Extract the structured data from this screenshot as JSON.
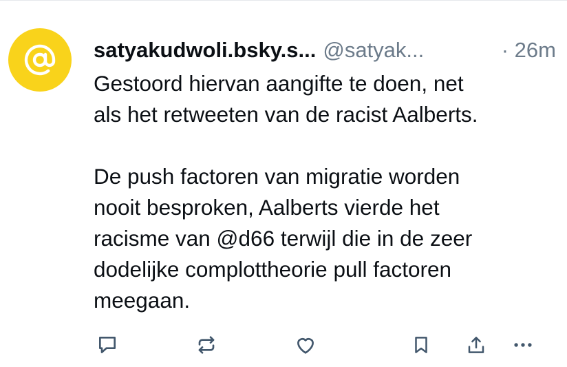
{
  "post": {
    "display_name": "satyakudwoli.bsky.s...",
    "handle": "@satyak...",
    "time": "· 26m",
    "avatar_icon": "at-sign-icon",
    "avatar_color": "#f9d31b",
    "paragraph_1_line_1": "Gestoord hiervan aangifte te doen, net",
    "paragraph_1_line_2": "als het retweeten van de racist Aalberts.",
    "paragraph_2_line_1": "De push factoren van migratie worden",
    "paragraph_2_line_2": "nooit besproken, Aalberts vierde het",
    "paragraph_2_line_3": "racisme van @d66 terwijl die in de zeer",
    "paragraph_2_line_4": "dodelijke complottheorie pull factoren",
    "paragraph_2_line_5": "meegaan."
  },
  "actions": [
    {
      "icon": "reply-icon"
    },
    {
      "icon": "repost-icon"
    },
    {
      "icon": "like-icon"
    },
    {
      "icon": "bookmark-icon"
    },
    {
      "icon": "share-icon"
    },
    {
      "icon": "more-options-icon"
    }
  ],
  "colors": {
    "text": "#0b0f14",
    "muted": "#6c7b8a",
    "icon": "#42576c"
  }
}
